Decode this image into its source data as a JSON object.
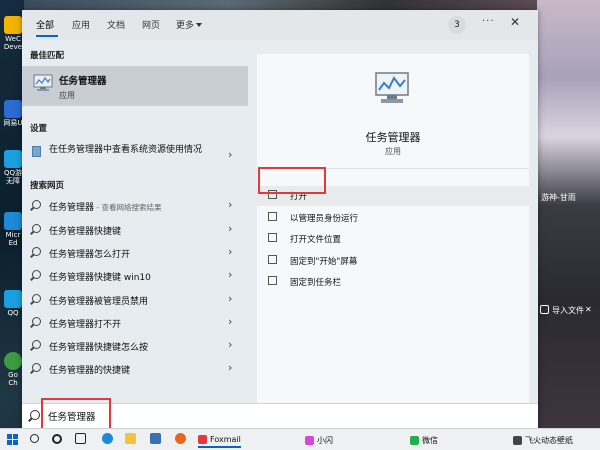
{
  "tabs": [
    "全部",
    "应用",
    "文档",
    "网页"
  ],
  "tabs_more": "更多",
  "result_count": "3",
  "header_menu": "···",
  "close_label": "✕",
  "sections": {
    "best_match": "最佳匹配",
    "settings": "设置",
    "web": "搜索网页"
  },
  "best_match_item": {
    "title": "任务管理器",
    "subtitle": "应用"
  },
  "settings_item": {
    "label": "在任务管理器中查看系统资源使用情况"
  },
  "web_items": [
    {
      "label": "任务管理器",
      "suffix": " - 查看网络搜索结果"
    },
    {
      "label": "任务管理器快捷键",
      "suffix": ""
    },
    {
      "label": "任务管理器怎么打开",
      "suffix": ""
    },
    {
      "label": "任务管理器快捷键 win10",
      "suffix": ""
    },
    {
      "label": "任务管理器被管理员禁用",
      "suffix": ""
    },
    {
      "label": "任务管理器打不开",
      "suffix": ""
    },
    {
      "label": "任务管理器快捷键怎么按",
      "suffix": ""
    },
    {
      "label": "任务管理器的快捷键",
      "suffix": ""
    }
  ],
  "details": {
    "title": "任务管理器",
    "subtitle": "应用",
    "actions": [
      "打开",
      "以管理员身份运行",
      "打开文件位置",
      "固定到\"开始\"屏幕",
      "固定到任务栏"
    ]
  },
  "search": {
    "value": "任务管理器"
  },
  "taskbar": {
    "apps": [
      "Foxmail",
      "小闪",
      "微信",
      "飞火动态壁纸"
    ]
  },
  "desktop": {
    "left_labels": [
      "We",
      "WeC",
      "Deve",
      "网易U",
      "QQ游",
      "无障",
      "Micr",
      "Ed",
      "QQ",
      "Go",
      "Ch"
    ],
    "right_text": "游神-甘雨",
    "right_button": "导入文件"
  },
  "colors": {
    "accent": "#0a63c9",
    "highlight_box": "#e23a3a",
    "best_match_bg": "#c8ced4"
  }
}
